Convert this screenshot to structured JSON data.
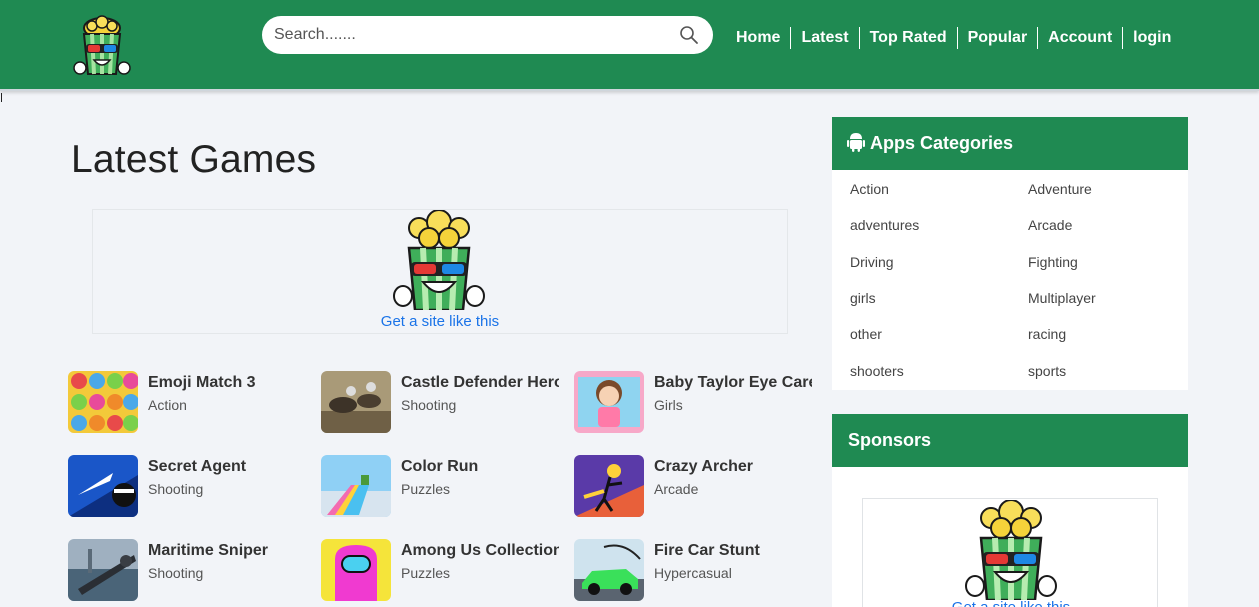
{
  "header": {
    "search_placeholder": "Search.......",
    "nav": [
      "Home",
      "Latest",
      "Top Rated",
      "Popular",
      "Account",
      "login"
    ]
  },
  "main": {
    "title": "Latest Games",
    "promo_link": "Get a site like this",
    "games": [
      {
        "title": "Emoji Match 3",
        "category": "Action"
      },
      {
        "title": "Castle Defender Hero",
        "category": "Shooting"
      },
      {
        "title": "Baby Taylor Eye Care",
        "category": "Girls"
      },
      {
        "title": "Secret Agent",
        "category": "Shooting"
      },
      {
        "title": "Color Run",
        "category": "Puzzles"
      },
      {
        "title": "Crazy Archer",
        "category": "Arcade"
      },
      {
        "title": "Maritime Sniper",
        "category": "Shooting"
      },
      {
        "title": "Among Us Collection",
        "category": "Puzzles"
      },
      {
        "title": "Fire Car Stunt",
        "category": "Hypercasual"
      }
    ]
  },
  "sidebar": {
    "categories_title": "Apps Categories",
    "categories": [
      "Action",
      "Adventure",
      "adventures",
      "Arcade",
      "Driving",
      "Fighting",
      "girls",
      "Multiplayer",
      "other",
      "racing",
      "shooters",
      "sports"
    ],
    "sponsors_title": "Sponsors",
    "sponsor_link": "Get a site like this"
  },
  "colors": {
    "brand_green": "#1f8a52",
    "link_blue": "#1a73e8",
    "page_bg": "#f2f4f8"
  }
}
